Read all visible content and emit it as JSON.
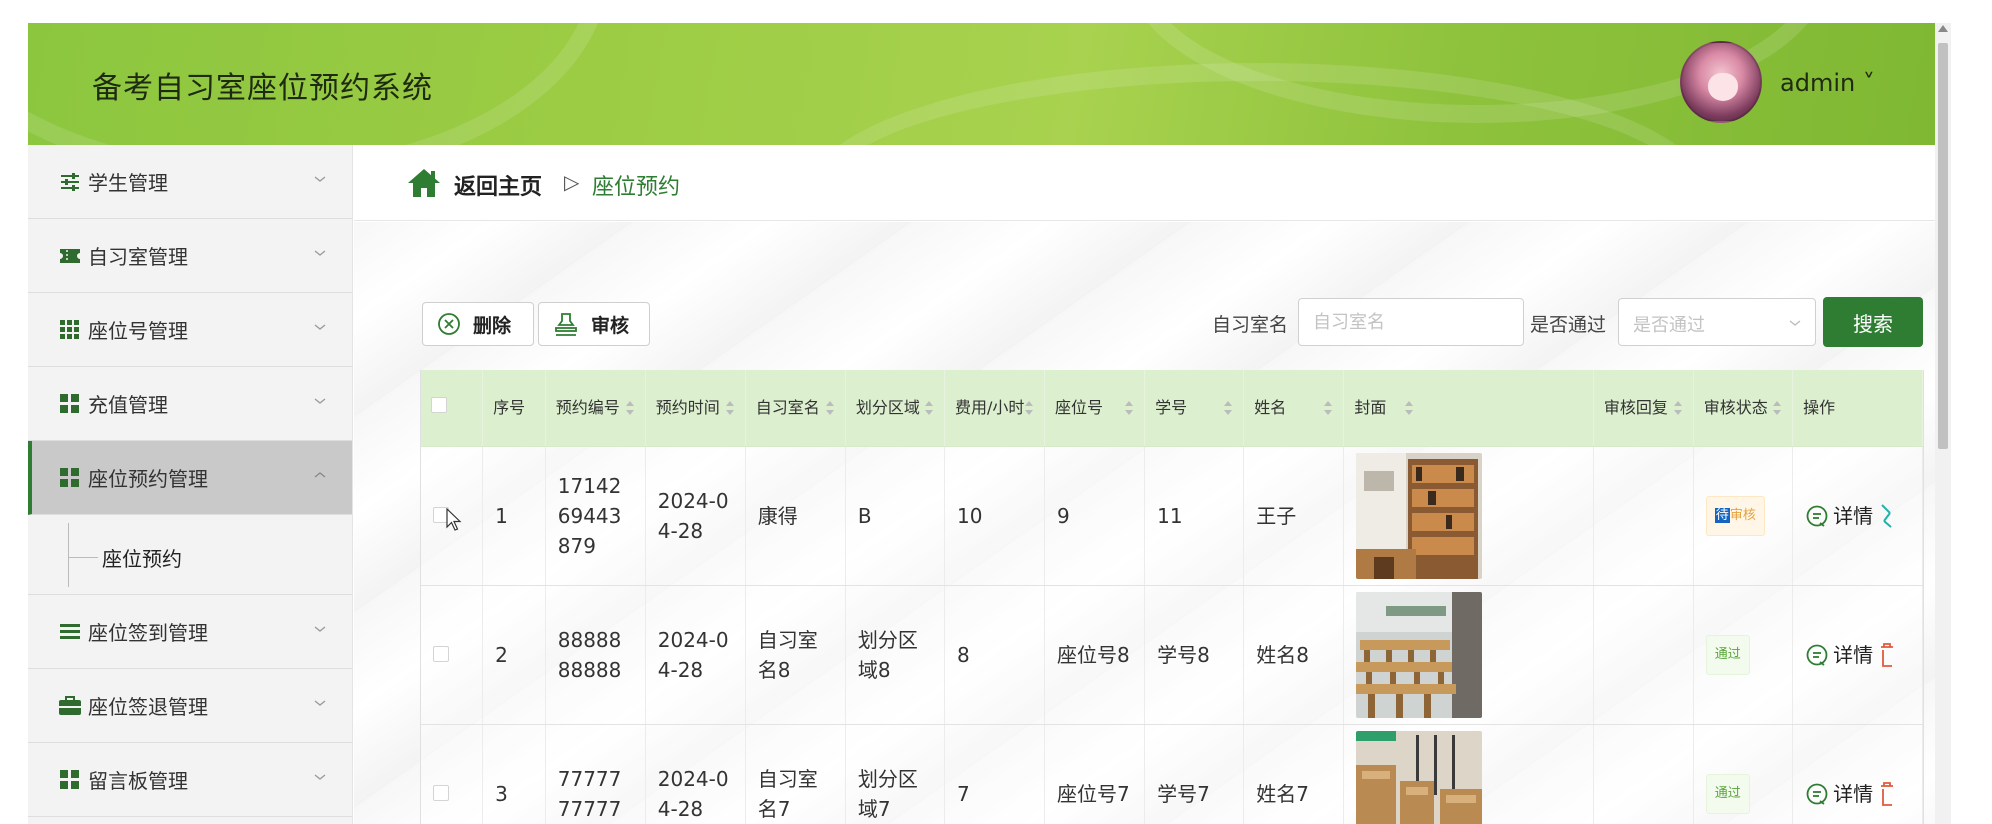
{
  "header": {
    "title": "备考自习室座位预约系统",
    "username": "admin ˅"
  },
  "sidebar": {
    "items": [
      {
        "label": "学生管理",
        "icon": "sliders-icon"
      },
      {
        "label": "自习室管理",
        "icon": "ticket-icon"
      },
      {
        "label": "座位号管理",
        "icon": "grid-icon"
      },
      {
        "label": "充值管理",
        "icon": "apps-icon"
      },
      {
        "label": "座位预约管理",
        "icon": "apps-icon"
      },
      {
        "label": "座位签到管理",
        "icon": "list-icon"
      },
      {
        "label": "座位签退管理",
        "icon": "briefcase-icon"
      },
      {
        "label": "留言板管理",
        "icon": "apps-icon"
      }
    ],
    "submenu": {
      "label": "座位预约"
    }
  },
  "breadcrumb": {
    "home": "返回主页",
    "separator": "▷",
    "current": "座位预约"
  },
  "toolbar": {
    "delete_label": "删除",
    "audit_label": "审核",
    "room_label": "自习室名",
    "room_placeholder": "自习室名",
    "pass_label": "是否通过",
    "pass_placeholder": "是否通过",
    "search_label": "搜索"
  },
  "table": {
    "columns": [
      "序号",
      "预约编号",
      "预约时间",
      "自习室名",
      "划分区域",
      "费用/小时",
      "座位号",
      "学号",
      "姓名",
      "封面",
      "审核回复",
      "审核状态",
      "操作"
    ],
    "rows": [
      {
        "index": "1",
        "order_no": "1714269443879",
        "time": "2024-04-28",
        "room": "康得",
        "area": "B",
        "fee": "10",
        "seat": "9",
        "student_no": "11",
        "name": "王子",
        "reply": "",
        "status_hl": "待",
        "status_rest": "审核",
        "status_type": "pending",
        "detail": "详情"
      },
      {
        "index": "2",
        "order_no": "8888888888",
        "time": "2024-04-28",
        "room": "自习室名8",
        "area": "划分区域8",
        "fee": "8",
        "seat": "座位号8",
        "student_no": "学号8",
        "name": "姓名8",
        "reply": "",
        "status_hl": "",
        "status_rest": "通过",
        "status_type": "pass",
        "detail": "详情"
      },
      {
        "index": "3",
        "order_no": "7777777777",
        "time": "2024-04-28",
        "room": "自习室名7",
        "area": "划分区域7",
        "fee": "7",
        "seat": "座位号7",
        "student_no": "学号7",
        "name": "姓名7",
        "reply": "",
        "status_hl": "",
        "status_rest": "通过",
        "status_type": "pass",
        "detail": "详情"
      }
    ]
  },
  "colors": {
    "header_green": "#9ccc44",
    "accent": "#2e7d32",
    "table_header": "#dcefcf"
  }
}
